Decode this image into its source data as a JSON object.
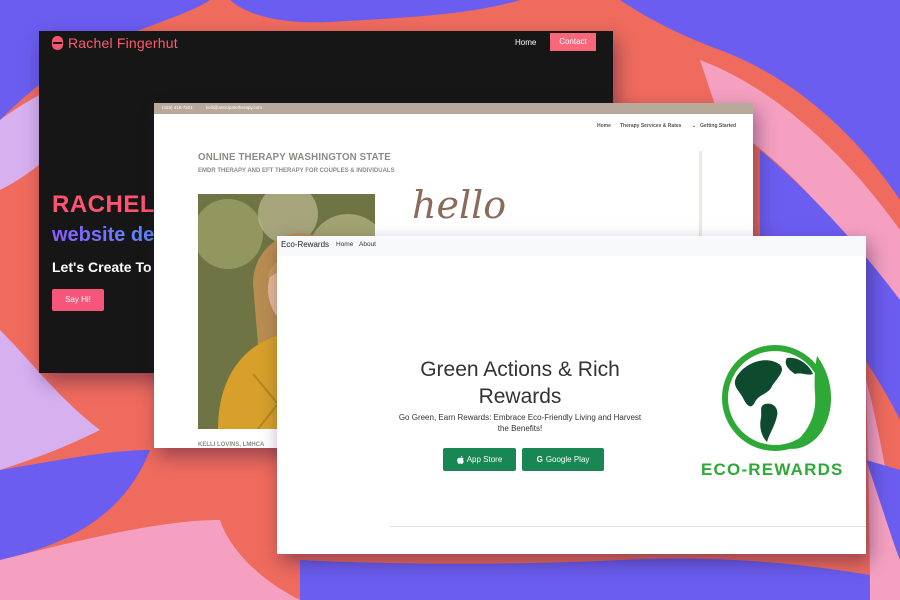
{
  "rachel_site": {
    "logo_text": "Rachel Fingerhut",
    "nav_home": "Home",
    "nav_contact": "Contact",
    "hero_name": "RACHEL",
    "hero_role": "website de",
    "hero_tagline": "Let's Create To",
    "cta": "Say Hi!"
  },
  "therapy_site": {
    "topbar_phone": "(425) 418-7221",
    "topbar_email": "kelli@anticipatetherapy.com",
    "menu": [
      "Home",
      "Therapy Services & Rates",
      "Getting Started"
    ],
    "title": "ONLINE THERAPY WASHINGTON STATE",
    "subtitle": "EMDR THERAPY AND EFT THERAPY FOR COUPLES & INDIVIDUALS",
    "hello": "hello",
    "caption": "KELLI LOVINS, LMHCA"
  },
  "eco_site": {
    "brand": "Eco-Rewards",
    "nav": [
      "Home",
      "About"
    ],
    "headline": "Green Actions & Rich Rewards",
    "tagline": "Go Green, Earn Rewards: Embrace Eco-Friendly Living and Harvest the Benefits!",
    "app_store": "App Store",
    "google_play": "Google Play",
    "logo_text": "ECO-REWARDS",
    "accent": "#198754",
    "logo_green": "#2ea836"
  }
}
